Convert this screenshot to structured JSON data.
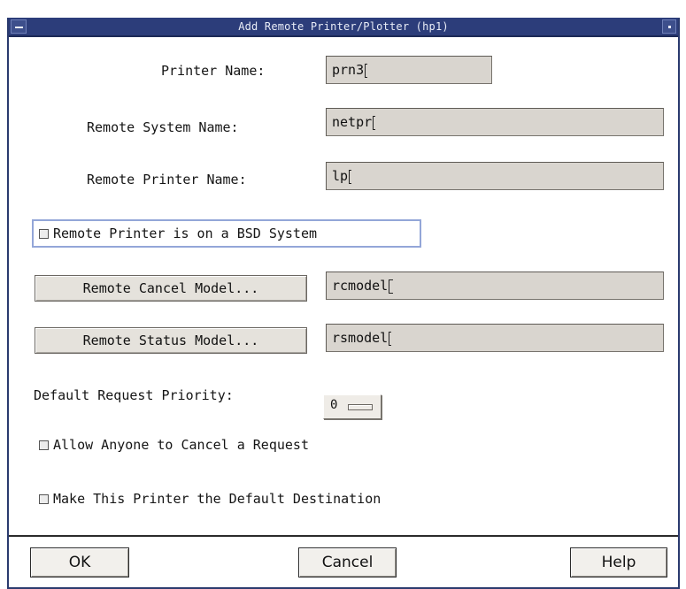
{
  "window": {
    "title": "Add Remote Printer/Plotter (hp1)"
  },
  "form": {
    "printer_name_label": "Printer Name:",
    "printer_name_value": "prn3",
    "remote_system_label": "Remote System Name:",
    "remote_system_value": "netpr",
    "remote_printer_label": "Remote Printer Name:",
    "remote_printer_value": "lp",
    "bsd_label": "Remote Printer is on a BSD System",
    "bsd_checked": false,
    "cancel_model_button": "Remote Cancel Model...",
    "cancel_model_value": "rcmodel",
    "status_model_button": "Remote Status Model...",
    "status_model_value": "rsmodel",
    "priority_label": "Default Request Priority:",
    "priority_value": "0",
    "allow_cancel_label": "Allow Anyone to Cancel a Request",
    "allow_cancel_checked": false,
    "default_dest_label": "Make This Printer the Default Destination",
    "default_dest_checked": false
  },
  "buttons": {
    "ok": "OK",
    "cancel": "Cancel",
    "help": "Help"
  },
  "colors": {
    "titlebar": "#2c3d7a",
    "field_bg": "#d9d5cf",
    "focus_frame": "#93a6d8"
  }
}
